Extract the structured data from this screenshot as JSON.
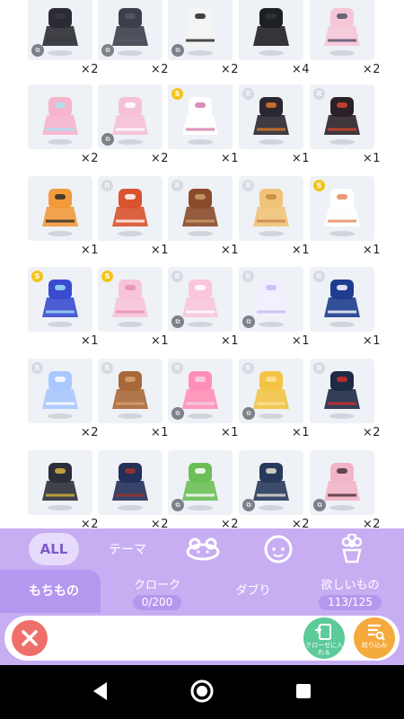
{
  "items": [
    {
      "qty": "×2",
      "icon": "black-tshirt-icon",
      "badge": "",
      "chip": true
    },
    {
      "qty": "×2",
      "icon": "dark-jeans-icon",
      "badge": "",
      "chip": true
    },
    {
      "qty": "×2",
      "icon": "sneakers-icon",
      "badge": "",
      "chip": true
    },
    {
      "qty": "×4",
      "icon": "black-hair-icon",
      "badge": "",
      "chip": false
    },
    {
      "qty": "×2",
      "icon": "pink-top-skirt-icon",
      "badge": "",
      "chip": false
    },
    {
      "qty": "×2",
      "icon": "striped-socks-icon",
      "badge": "",
      "chip": false
    },
    {
      "qty": "×2",
      "icon": "rose-hat-icon",
      "badge": "",
      "chip": true
    },
    {
      "qty": "×1",
      "icon": "pink-eyes-icon",
      "badge": "S",
      "chip": false
    },
    {
      "qty": "×1",
      "icon": "dark-coat-icon",
      "badge": "R",
      "chip": false
    },
    {
      "qty": "×1",
      "icon": "dark-dress-icon",
      "badge": "R",
      "chip": false
    },
    {
      "qty": "×1",
      "icon": "orange-boots-icon",
      "badge": "",
      "chip": false
    },
    {
      "qty": "×1",
      "icon": "ribbon-hair-icon",
      "badge": "R",
      "chip": false
    },
    {
      "qty": "×1",
      "icon": "staff-icon",
      "badge": "R",
      "chip": false
    },
    {
      "qty": "×1",
      "icon": "gold-wings-icon",
      "badge": "R",
      "chip": false
    },
    {
      "qty": "×1",
      "icon": "face-icon",
      "badge": "S",
      "chip": false
    },
    {
      "qty": "×1",
      "icon": "blue-perfume-icon",
      "badge": "S",
      "chip": false
    },
    {
      "qty": "×1",
      "icon": "pink-perfume-icon",
      "badge": "S",
      "chip": false
    },
    {
      "qty": "×1",
      "icon": "pink-gown-icon",
      "badge": "R",
      "chip": true
    },
    {
      "qty": "×1",
      "icon": "white-gown-icon",
      "badge": "R",
      "chip": true
    },
    {
      "qty": "×1",
      "icon": "navy-dress-icon",
      "badge": "R",
      "chip": false
    },
    {
      "qty": "×2",
      "icon": "blue-heart-dress-icon",
      "badge": "R",
      "chip": false
    },
    {
      "qty": "×1",
      "icon": "brown-argyle-dress-icon",
      "badge": "R",
      "chip": false
    },
    {
      "qty": "×1",
      "icon": "pink-polka-skirt-icon",
      "badge": "R",
      "chip": true
    },
    {
      "qty": "×1",
      "icon": "gold-dress-icon",
      "badge": "R",
      "chip": true
    },
    {
      "qty": "×2",
      "icon": "sailor-uniform-icon",
      "badge": "R",
      "chip": false
    },
    {
      "qty": "×2",
      "icon": "black-school-uniform-icon",
      "badge": "",
      "chip": false
    },
    {
      "qty": "×2",
      "icon": "navy-jacket-icon",
      "badge": "",
      "chip": false
    },
    {
      "qty": "×2",
      "icon": "green-vest-icon",
      "badge": "",
      "chip": true
    },
    {
      "qty": "×2",
      "icon": "blazer-shorts-icon",
      "badge": "",
      "chip": true
    },
    {
      "qty": "×2",
      "icon": "pink-frill-dress-icon",
      "badge": "",
      "chip": true
    }
  ],
  "categories": {
    "all": "ALL",
    "theme": "テーマ"
  },
  "tabs": {
    "mochimono": "もちもの",
    "cloak": "クローク",
    "cloak_count": "0/200",
    "daburi": "ダブり",
    "wishlist": "欲しいもの",
    "wishlist_count": "113/125"
  },
  "actions": {
    "cloak_button": "クローゼに入れる",
    "filter_button": "絞り込み"
  }
}
